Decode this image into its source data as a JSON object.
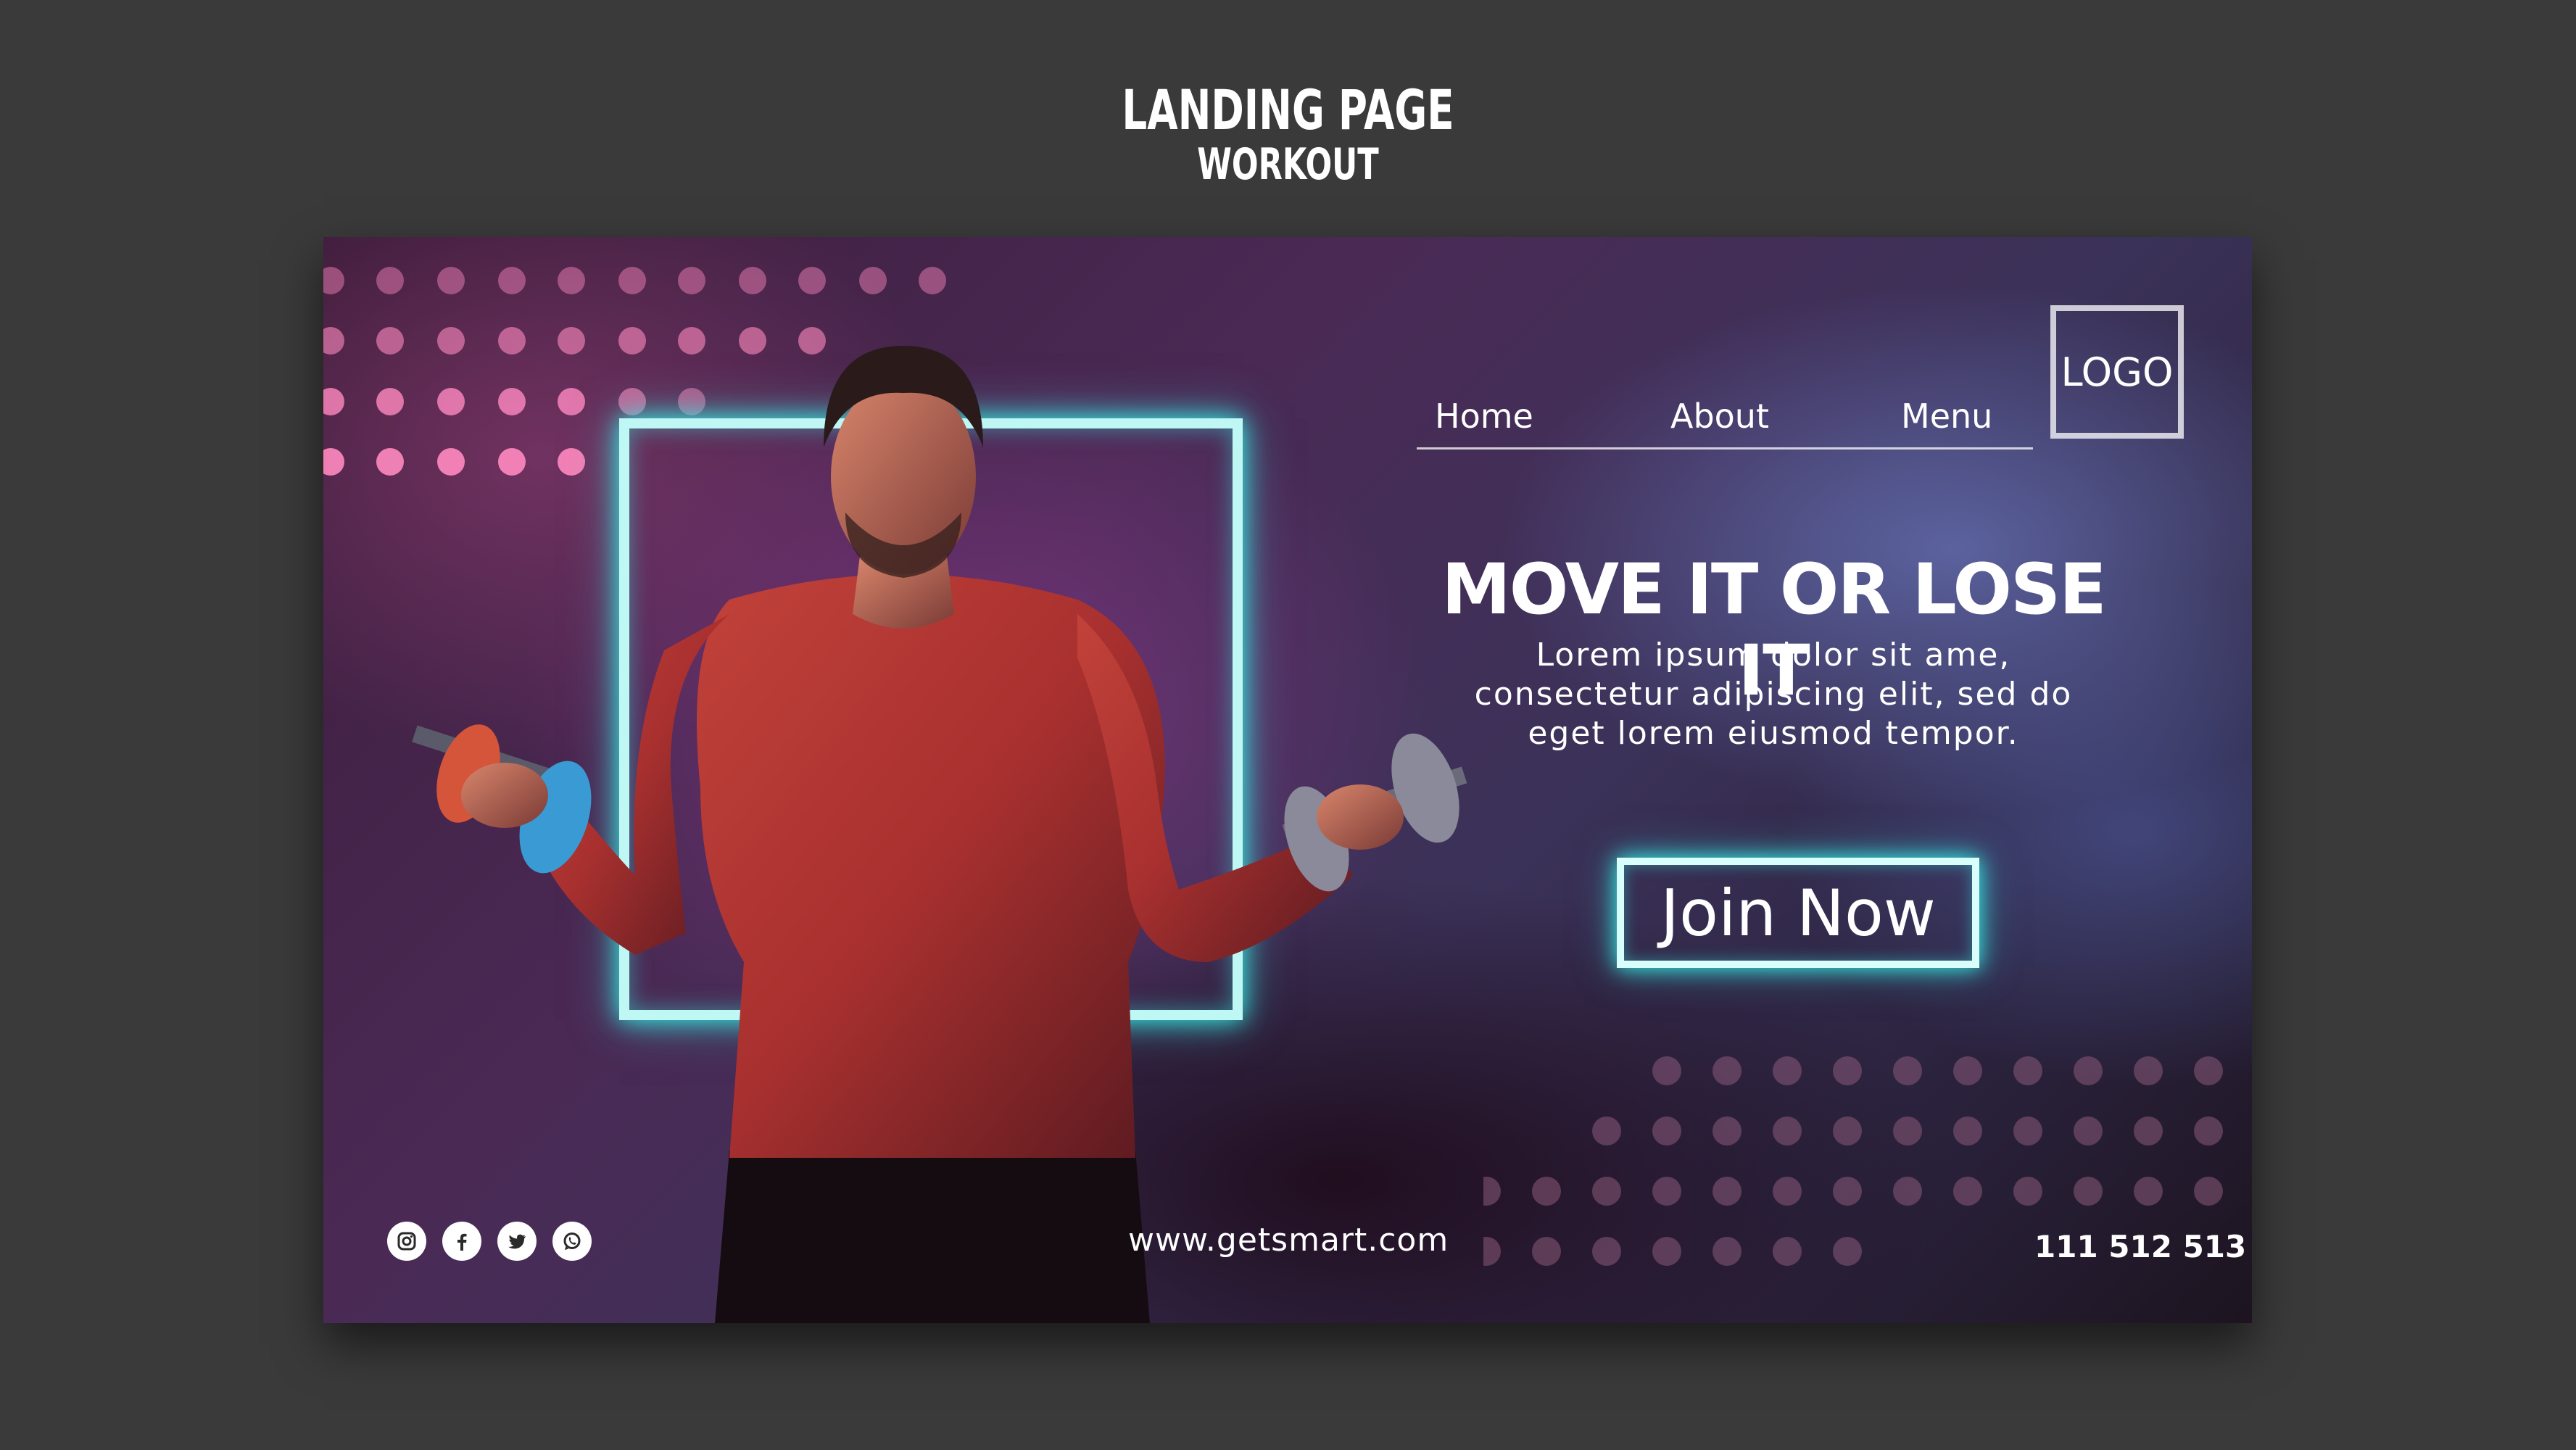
{
  "header": {
    "title": "LANDING PAGE",
    "subtitle": "WORKOUT"
  },
  "nav": {
    "items": [
      {
        "label": "Home"
      },
      {
        "label": "About"
      },
      {
        "label": "Menu"
      }
    ]
  },
  "logo": {
    "text": "LOGO"
  },
  "hero": {
    "headline": "MOVE IT OR LOSE IT",
    "body_lines": [
      "Lorem ipsum dolor sit ame,",
      "consectetur adipiscing elit, sed do",
      "eget lorem eiusmod tempor."
    ],
    "cta_label": "Join Now"
  },
  "footer": {
    "website": "www.getsmart.com",
    "phone": "111 512 513",
    "social_icons": [
      "instagram-icon",
      "facebook-icon",
      "twitter-icon",
      "whatsapp-icon"
    ]
  },
  "colors": {
    "neon": "#36e6e0",
    "background": "#3a3a3a",
    "text": "#ffffff",
    "dot_pink": "#ff8ac0"
  }
}
